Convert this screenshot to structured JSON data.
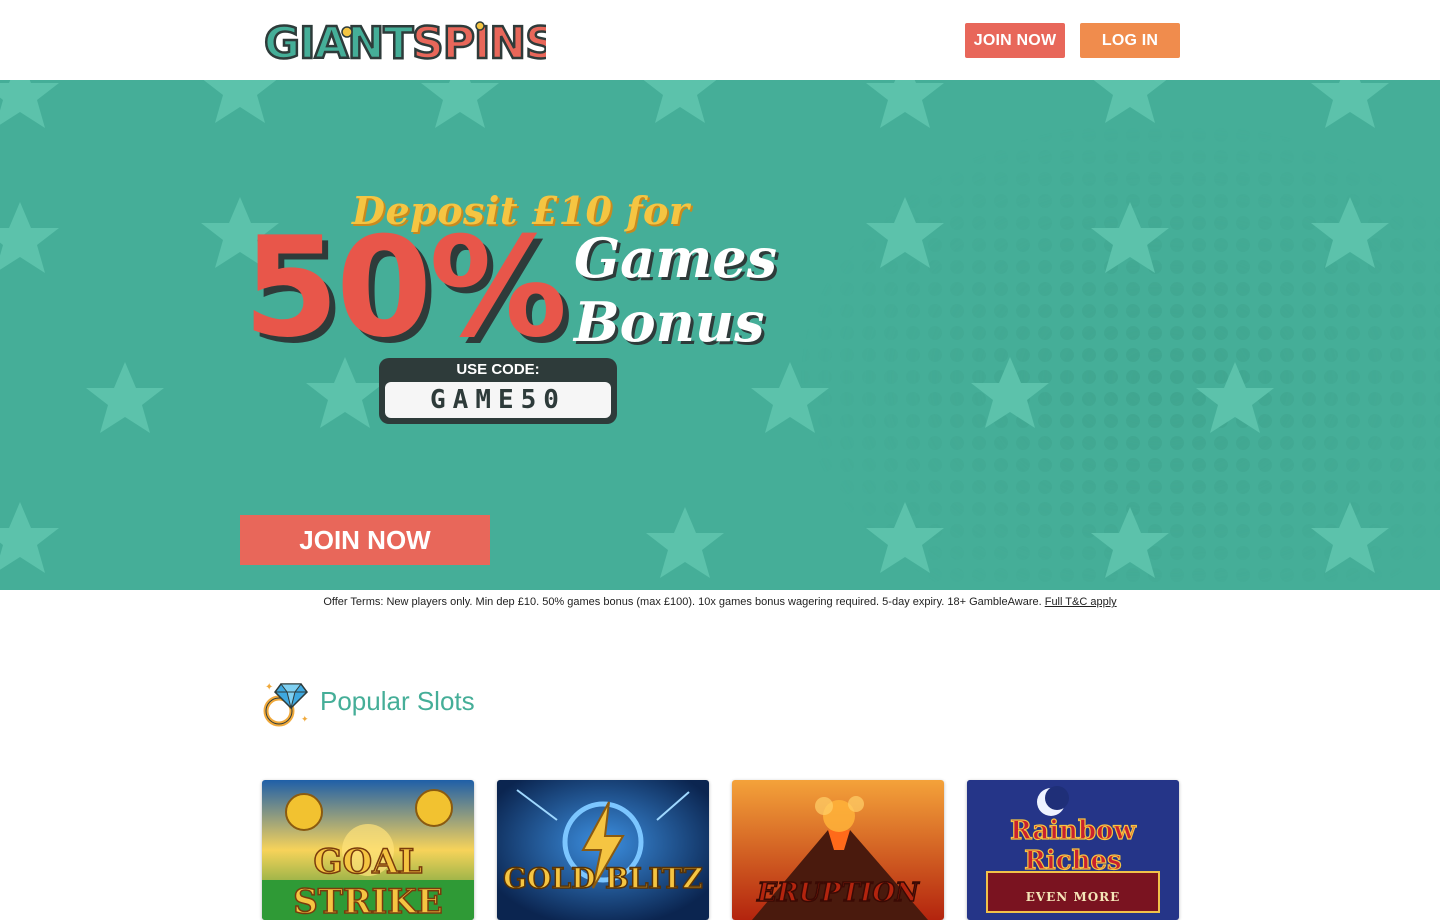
{
  "header": {
    "logo_text": "GIANT SPINS",
    "join_label": "JOIN NOW",
    "login_label": "LOG IN"
  },
  "hero": {
    "headline_top": "Deposit £10 for",
    "percent": "50%",
    "line_games": "Games",
    "line_bonus": "Bonus",
    "code_label": "USE CODE:",
    "code_value": "GAME50",
    "join_label": "JOIN NOW"
  },
  "terms": {
    "text": "Offer Terms: New players only. Min dep £10. 50% games bonus (max £100). 10x games bonus wagering required. 5-day expiry. 18+ GambleAware. ",
    "link_label": "Full T&C apply"
  },
  "popular": {
    "title": "Popular Slots",
    "slots": [
      {
        "title": "GOAL STRIKE"
      },
      {
        "title": "GOLD BLITZ"
      },
      {
        "title": "ERUPTION"
      },
      {
        "title": "Rainbow Riches",
        "subtitle": "EVEN MORE"
      }
    ]
  },
  "colors": {
    "teal": "#45ae98",
    "red": "#e8675a",
    "orange": "#f08c4d",
    "yellow": "#f5c542"
  }
}
